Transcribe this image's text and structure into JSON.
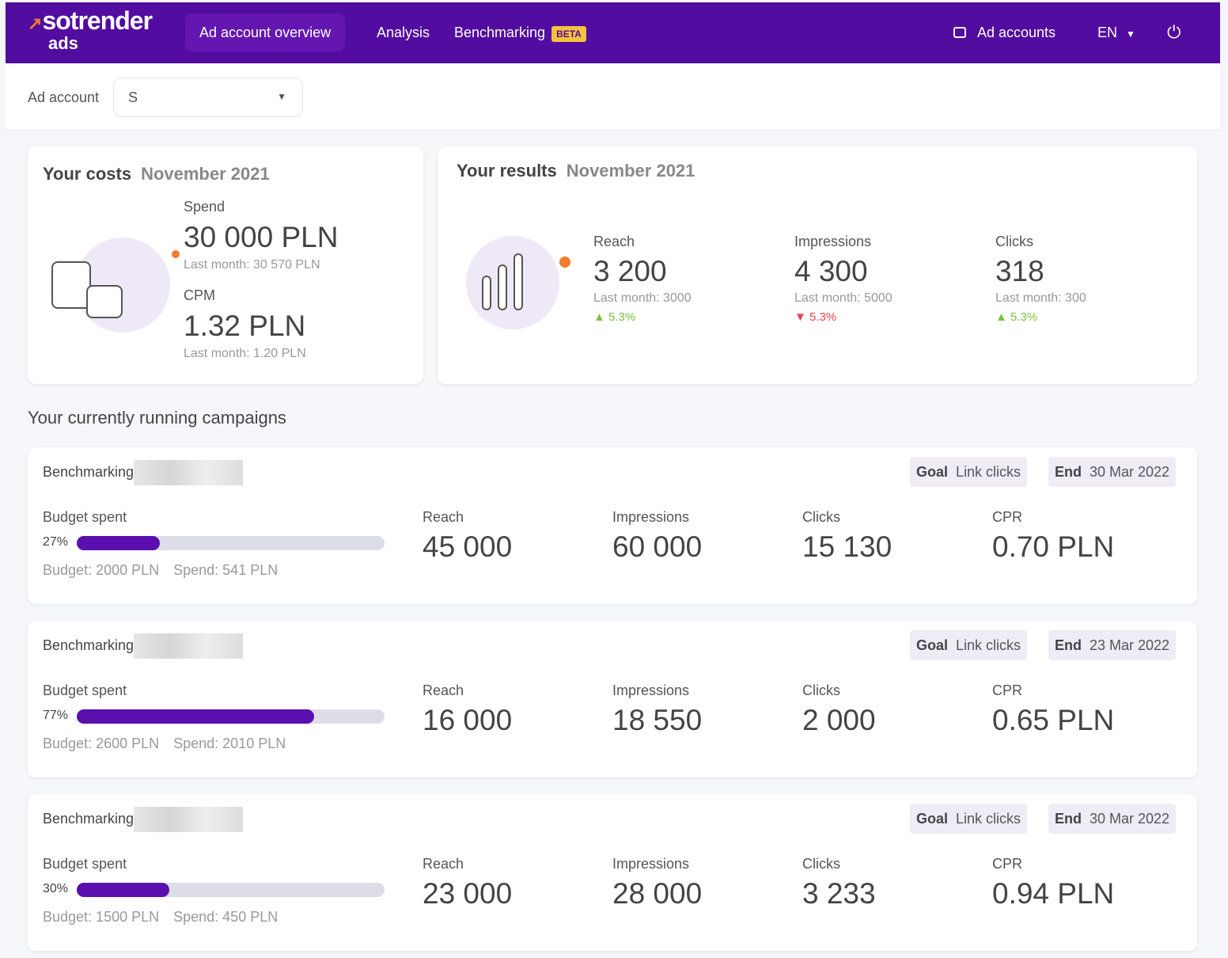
{
  "nav": {
    "logo_main": "sotrender",
    "logo_sub": "ads",
    "items": [
      "Ad account overview",
      "Analysis",
      "Benchmarking"
    ],
    "beta": "BETA",
    "ad_accounts": "Ad accounts",
    "lang": "EN",
    "brand_color": "#520c9f"
  },
  "account": {
    "label": "Ad account",
    "value": "S"
  },
  "costs": {
    "title": "Your costs",
    "date": "November 2021",
    "spend_label": "Spend",
    "spend": "30 000 PLN",
    "spend_last": "Last month: 30 570 PLN",
    "cpm_label": "CPM",
    "cpm": "1.32 PLN",
    "cpm_last": "Last month: 1.20 PLN"
  },
  "results": {
    "title": "Your results",
    "date": "November 2021",
    "metrics": [
      {
        "label": "Reach",
        "value": "3 200",
        "last": "Last month: 3000",
        "change": "5.3%",
        "dir": "up"
      },
      {
        "label": "Impressions",
        "value": "4 300",
        "last": "Last month: 5000",
        "change": "5.3%",
        "dir": "down"
      },
      {
        "label": "Clicks",
        "value": "318",
        "last": "Last month: 300",
        "change": "5.3%",
        "dir": "up"
      }
    ]
  },
  "campaigns_title": "Your currently running campaigns",
  "campaign_labels": {
    "budget_spent": "Budget spent",
    "reach": "Reach",
    "impressions": "Impressions",
    "clicks": "Clicks",
    "cpr": "CPR",
    "goal": "Goal",
    "end": "End"
  },
  "campaigns": [
    {
      "name": "Benchmarking",
      "goal": "Link clicks",
      "end": "30 Mar 2022",
      "percent": 27,
      "percent_text": "27%",
      "budget": "Budget: 2000 PLN",
      "spend": "Spend: 541 PLN",
      "reach": "45 000",
      "impressions": "60 000",
      "clicks": "15 130",
      "cpr": "0.70 PLN"
    },
    {
      "name": "Benchmarking",
      "goal": "Link clicks",
      "end": "23 Mar 2022",
      "percent": 77,
      "percent_text": "77%",
      "budget": "Budget: 2600 PLN",
      "spend": "Spend: 2010 PLN",
      "reach": "16 000",
      "impressions": "18 550",
      "clicks": "2 000",
      "cpr": "0.65 PLN"
    },
    {
      "name": "Benchmarking",
      "goal": "Link clicks",
      "end": "30 Mar 2022",
      "percent": 30,
      "percent_text": "30%",
      "budget": "Budget: 1500 PLN",
      "spend": "Spend: 450 PLN",
      "reach": "23 000",
      "impressions": "28 000",
      "clicks": "3 233",
      "cpr": "0.94 PLN"
    }
  ]
}
